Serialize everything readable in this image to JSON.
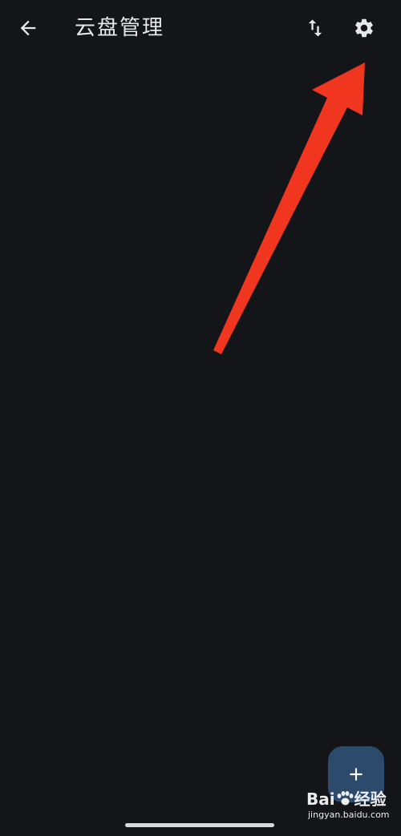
{
  "header": {
    "title": "云盘管理",
    "back_icon": "arrow-left-icon",
    "sort_icon": "sort-arrows-icon",
    "settings_icon": "gear-icon"
  },
  "fab": {
    "icon": "plus-icon",
    "color": "#2c4a6b"
  },
  "annotation": {
    "type": "arrow",
    "color": "#f0361f",
    "target": "settings-button"
  },
  "watermark": {
    "brand_prefix": "Bai",
    "brand_suffix": "经验",
    "url": "jingyan.baidu.com"
  },
  "theme": {
    "background": "#141519",
    "foreground": "#e8e8ec"
  }
}
